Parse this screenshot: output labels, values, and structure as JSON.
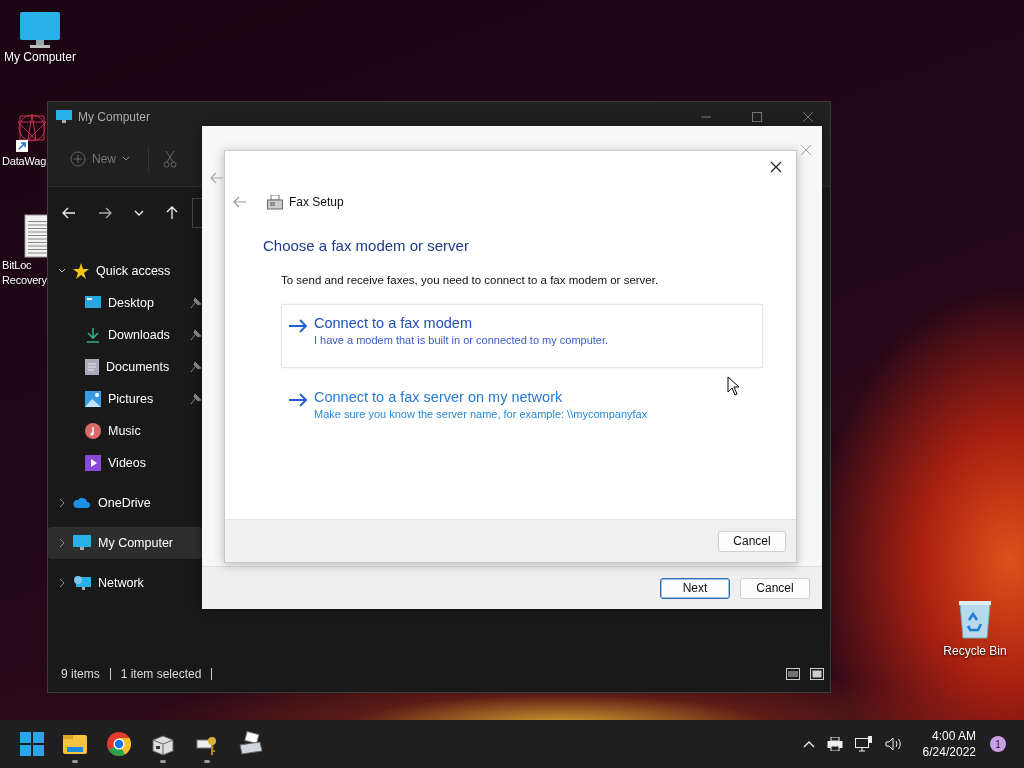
{
  "desktop_icons": [
    {
      "kind": "computer",
      "lines": [
        "My Computer"
      ]
    },
    {
      "kind": "app",
      "lines": [
        "DataWag"
      ]
    },
    {
      "kind": "document",
      "lines": [
        "BitLoc",
        "Recovery"
      ]
    }
  ],
  "recycle_bin": {
    "label": "Recycle Bin"
  },
  "explorer": {
    "title": "My Computer",
    "toolbar": {
      "new_label": "New"
    },
    "sidebar": [
      {
        "kind": "star",
        "label": "Quick access",
        "expanded": true,
        "selected": false,
        "children": [
          {
            "kind": "desktop",
            "label": "Desktop",
            "pinned": true
          },
          {
            "kind": "downloads",
            "label": "Downloads",
            "pinned": true
          },
          {
            "kind": "documents",
            "label": "Documents",
            "pinned": true
          },
          {
            "kind": "pictures",
            "label": "Pictures",
            "pinned": true
          },
          {
            "kind": "music",
            "label": "Music",
            "pinned": false
          },
          {
            "kind": "videos",
            "label": "Videos",
            "pinned": false
          }
        ]
      },
      {
        "kind": "cloud",
        "label": "OneDrive",
        "expanded": false,
        "selected": false
      },
      {
        "kind": "computer",
        "label": "My Computer",
        "expanded": false,
        "selected": true
      },
      {
        "kind": "network",
        "label": "Network",
        "expanded": false,
        "selected": false
      }
    ],
    "status_bar": {
      "item_count": "9 items",
      "selection": "1 item selected"
    }
  },
  "outer_dialog": {
    "buttons": [
      {
        "label": "Next",
        "default": true
      },
      {
        "label": "Cancel",
        "default": false
      }
    ]
  },
  "fax_dialog": {
    "title": "Fax Setup",
    "heading": "Choose a fax modem or server",
    "intro": "To send and receive faxes, you need to connect to a fax modem or server.",
    "options": [
      {
        "title": "Connect to a fax modem",
        "description": "I have a modem that is built in or connected to my computer.",
        "selected": true
      },
      {
        "title": "Connect to a fax server on my network",
        "description": "Make sure you know the server name, for example: \\\\mycompanyfax",
        "selected": false
      }
    ],
    "cancel_label": "Cancel"
  },
  "taskbar": {
    "apps": [
      {
        "kind": "explorer",
        "running": true
      },
      {
        "kind": "chrome",
        "running": false
      },
      {
        "kind": "drive",
        "running": true
      },
      {
        "kind": "keys",
        "running": true
      },
      {
        "kind": "fax",
        "running": false
      }
    ],
    "time": "4:00 AM",
    "date": "6/24/2022",
    "notifications": "1"
  }
}
